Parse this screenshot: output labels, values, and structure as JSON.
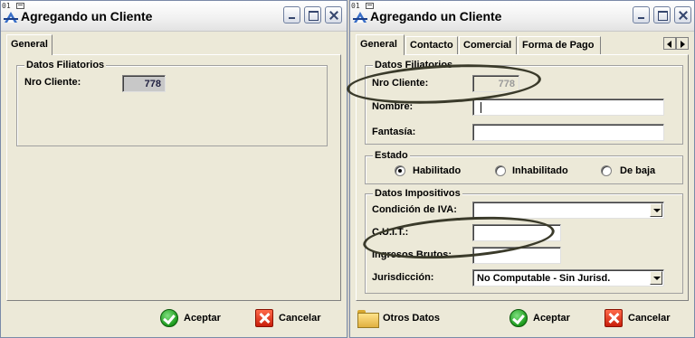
{
  "left_window": {
    "tag": "01",
    "title": "Agregando un Cliente",
    "tabs": [
      {
        "label": "General"
      }
    ],
    "datos_filiatorios": {
      "title": "Datos Filiatorios",
      "nro_cliente_label": "Nro Cliente:",
      "nro_cliente_value": "778"
    },
    "aceptar_label": "Aceptar",
    "cancelar_label": "Cancelar"
  },
  "right_window": {
    "tag": "01",
    "title": "Agregando un Cliente",
    "tabs": [
      {
        "label": "General"
      },
      {
        "label": "Contacto"
      },
      {
        "label": "Comercial"
      },
      {
        "label": "Forma de Pago"
      }
    ],
    "datos_filiatorios": {
      "title": "Datos Filiatorios",
      "nro_cliente_label": "Nro Cliente:",
      "nro_cliente_value": "778",
      "nombre_label": "Nombre:",
      "nombre_value": "",
      "fantasia_label": "Fantasía:",
      "fantasia_value": ""
    },
    "estado": {
      "title": "Estado",
      "options": [
        {
          "label": "Habilitado",
          "selected": true
        },
        {
          "label": "Inhabilitado",
          "selected": false
        },
        {
          "label": "De baja",
          "selected": false
        }
      ]
    },
    "datos_impositivos": {
      "title": "Datos Impositivos",
      "condicion_iva_label": "Condición de IVA:",
      "condicion_iva_value": "",
      "cuit_label": "C.U.I.T.:",
      "cuit_value": "",
      "ingresos_brutos_label": "Ingresos Brutos:",
      "ingresos_brutos_value": "",
      "jurisdiccion_label": "Jurisdicción:",
      "jurisdiccion_value": "No Computable - Sin Jurisd."
    },
    "otros_datos_label": "Otros Datos",
    "aceptar_label": "Aceptar",
    "cancelar_label": "Cancelar"
  },
  "icons": {
    "app": "app-logo-icon",
    "minimize": "minimize-icon",
    "maximize": "maximize-icon",
    "close": "close-icon",
    "aceptar": "checkmark-icon",
    "cancelar": "x-icon",
    "otros_datos": "folder-icon"
  },
  "colors": {
    "window_bg": "#ece9d8",
    "ok_green": "#1c9a1c",
    "cancel_red": "#c81e0a"
  }
}
